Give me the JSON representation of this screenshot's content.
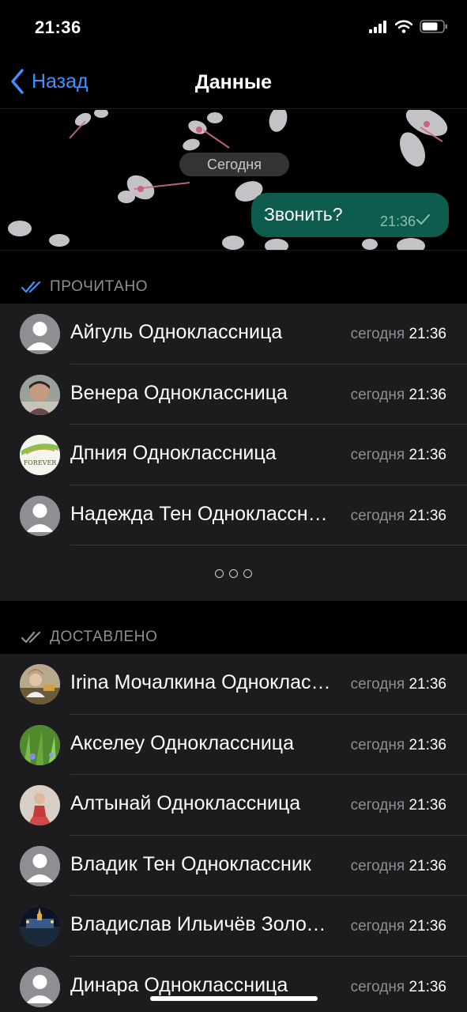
{
  "status_bar": {
    "time": "21:36"
  },
  "nav": {
    "back_label": "Назад",
    "title": "Данные"
  },
  "chat_preview": {
    "date_label": "Сегодня",
    "message": {
      "text": "Звонить?",
      "time": "21:36",
      "status_icon": "single-check-icon"
    }
  },
  "read_section": {
    "label": "ПРОЧИТАНО",
    "icon": "double-check-icon",
    "icon_color": "#3e92ff",
    "items": [
      {
        "name": "Айгуль Одноклассница",
        "day": "сегодня",
        "time": "21:36",
        "avatar": "placeholder"
      },
      {
        "name": "Венера Одноклассница",
        "day": "сегодня",
        "time": "21:36",
        "avatar": "photo"
      },
      {
        "name": "Дпния Одноклассница",
        "day": "сегодня",
        "time": "21:36",
        "avatar": "forever-logo"
      },
      {
        "name": "Надежда Тен Одноклассница",
        "day": "сегодня",
        "time": "21:36",
        "avatar": "placeholder"
      }
    ]
  },
  "delivered_section": {
    "label": "ДОСТАВЛЕНО",
    "icon": "double-check-icon",
    "icon_color": "#8e8e93",
    "items": [
      {
        "name": "Irina Мочалкина Одноклассница",
        "day": "сегодня",
        "time": "21:36",
        "avatar": "photo"
      },
      {
        "name": "Акселеу Одноклассница",
        "day": "сегодня",
        "time": "21:36",
        "avatar": "photo"
      },
      {
        "name": "Алтынай Одноклассница",
        "day": "сегодня",
        "time": "21:36",
        "avatar": "photo"
      },
      {
        "name": "Владик Тен Одноклассник",
        "day": "сегодня",
        "time": "21:36",
        "avatar": "placeholder"
      },
      {
        "name": "Владислав Ильичёв Золотой выпуск",
        "day": "сегодня",
        "time": "21:36",
        "avatar": "photo"
      },
      {
        "name": "Динара Одноклассница",
        "day": "сегодня",
        "time": "21:36",
        "avatar": "placeholder"
      }
    ]
  },
  "colors": {
    "accent": "#3e92ff",
    "bubble": "#0d5c4e",
    "list_bg": "#1c1c1e",
    "secondary_text": "#8e8e93"
  }
}
